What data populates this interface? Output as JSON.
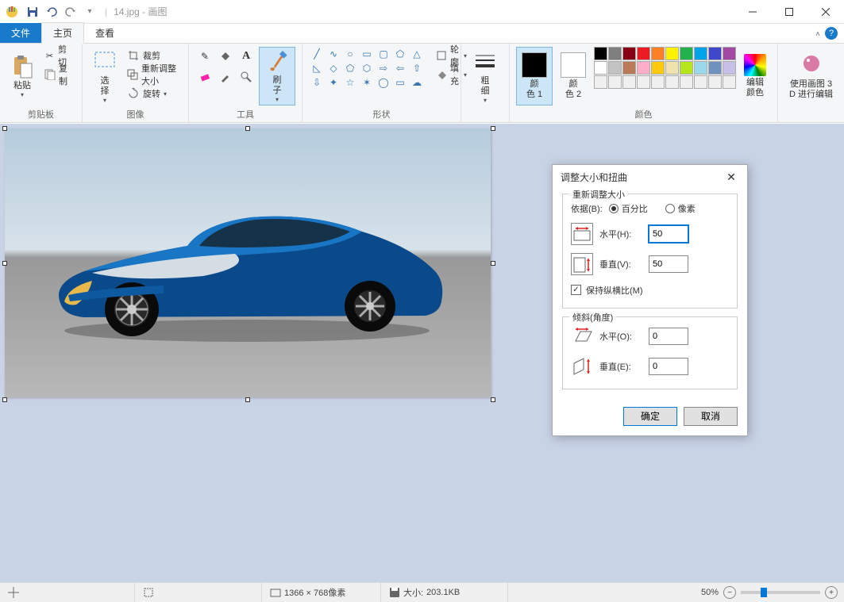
{
  "titlebar": {
    "filename": "14.jpg",
    "app_name": "画图"
  },
  "tabs": {
    "file": "文件",
    "home": "主页",
    "view": "查看"
  },
  "ribbon": {
    "clipboard": {
      "label": "剪贴板",
      "paste": "粘贴",
      "cut": "剪切",
      "copy": "复制"
    },
    "image": {
      "label": "图像",
      "select": "选\n择",
      "crop": "裁剪",
      "resize": "重新调整大小",
      "rotate": "旋转"
    },
    "tools": {
      "label": "工具",
      "brush": "刷\n子"
    },
    "shapes": {
      "label": "形状",
      "outline": "轮廓",
      "fill": "填充"
    },
    "size": {
      "label": "粗\n细"
    },
    "colors": {
      "label": "颜色",
      "color1": "颜\n色 1",
      "color2": "颜\n色 2",
      "edit": "编辑\n颜色",
      "row1": [
        "#000000",
        "#7f7f7f",
        "#880015",
        "#ed1c24",
        "#ff7f27",
        "#fff200",
        "#22b14c",
        "#00a2e8",
        "#3f48cc",
        "#a349a4"
      ],
      "row2": [
        "#ffffff",
        "#c3c3c3",
        "#b97a57",
        "#ffaec9",
        "#ffc90e",
        "#efe4b0",
        "#b5e61d",
        "#99d9ea",
        "#7092be",
        "#c8bfe7"
      ],
      "row3": [
        "#f0f0f0",
        "#f0f0f0",
        "#f0f0f0",
        "#f0f0f0",
        "#f0f0f0",
        "#f0f0f0",
        "#f0f0f0",
        "#f0f0f0",
        "#f0f0f0",
        "#f0f0f0"
      ]
    },
    "paint3d": "使用画图 3\nD 进行编辑"
  },
  "dialog": {
    "title": "调整大小和扭曲",
    "resize_legend": "重新调整大小",
    "by_label": "依据(B):",
    "percent": "百分比",
    "pixels": "像素",
    "horizontal": "水平(H):",
    "vertical": "垂直(V):",
    "h_value": "50",
    "v_value": "50",
    "keep_ratio": "保持纵横比(M)",
    "skew_legend": "倾斜(角度)",
    "skew_h": "水平(O):",
    "skew_v": "垂直(E):",
    "skew_h_value": "0",
    "skew_v_value": "0",
    "ok": "确定",
    "cancel": "取消"
  },
  "statusbar": {
    "dimensions": "1366 × 768像素",
    "size_label": "大小:",
    "size_value": "203.1KB",
    "zoom": "50%"
  }
}
